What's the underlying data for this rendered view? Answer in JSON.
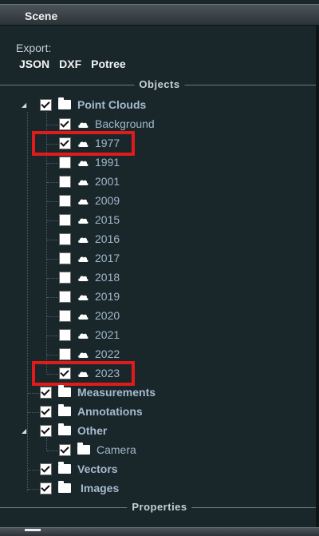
{
  "header": {
    "title": "Scene"
  },
  "export": {
    "label": "Export:",
    "buttons": [
      "JSON",
      "DXF",
      "Potree"
    ]
  },
  "sections": {
    "objects": "Objects",
    "properties": "Properties"
  },
  "tree": {
    "point_clouds": {
      "label": "Point Clouds",
      "checked": true,
      "expanded": true
    },
    "clouds": [
      {
        "label": "Background",
        "checked": true,
        "highlighted": false
      },
      {
        "label": "1977",
        "checked": true,
        "highlighted": true
      },
      {
        "label": "1991",
        "checked": false,
        "highlighted": false
      },
      {
        "label": "2001",
        "checked": false,
        "highlighted": false
      },
      {
        "label": "2009",
        "checked": false,
        "highlighted": false
      },
      {
        "label": "2015",
        "checked": false,
        "highlighted": false
      },
      {
        "label": "2016",
        "checked": false,
        "highlighted": false
      },
      {
        "label": "2017",
        "checked": false,
        "highlighted": false
      },
      {
        "label": "2018",
        "checked": false,
        "highlighted": false
      },
      {
        "label": "2019",
        "checked": false,
        "highlighted": false
      },
      {
        "label": "2020",
        "checked": false,
        "highlighted": false
      },
      {
        "label": "2021",
        "checked": false,
        "highlighted": false
      },
      {
        "label": "2022",
        "checked": false,
        "highlighted": false
      },
      {
        "label": "2023",
        "checked": true,
        "highlighted": true
      }
    ],
    "measurements": {
      "label": "Measurements",
      "checked": true
    },
    "annotations": {
      "label": "Annotations",
      "checked": true
    },
    "other": {
      "label": "Other",
      "checked": true,
      "expanded": true
    },
    "camera": {
      "label": "Camera",
      "checked": true
    },
    "vectors": {
      "label": "Vectors",
      "checked": true
    },
    "images": {
      "label": "Images",
      "checked": true
    }
  },
  "colors": {
    "highlight": "#e01b1b",
    "background": "#19272b"
  }
}
